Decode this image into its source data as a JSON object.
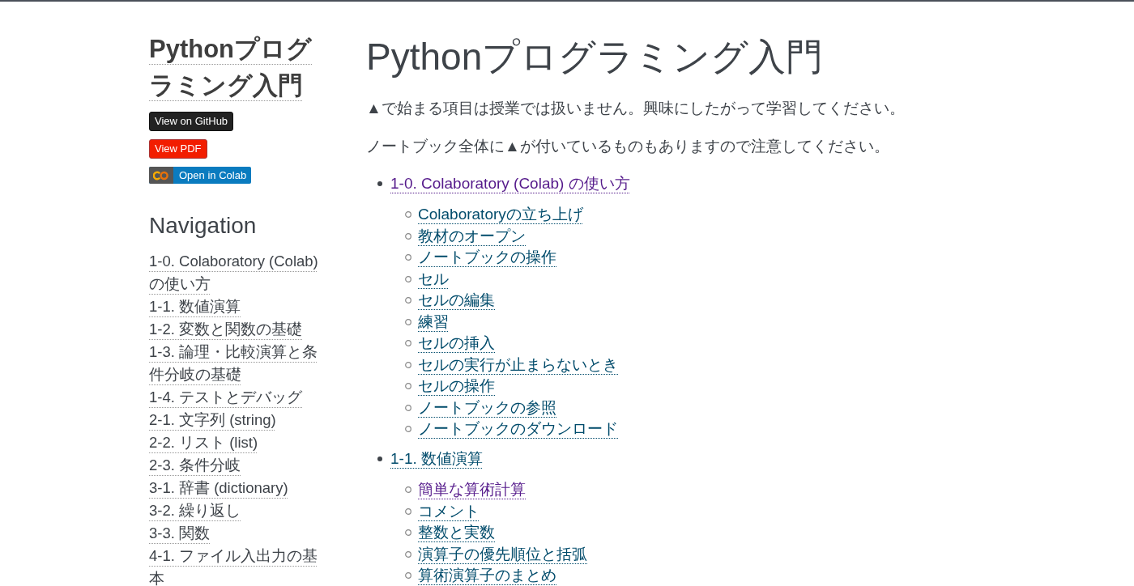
{
  "sidebar": {
    "title": "Pythonプログラミング入門",
    "badges": [
      {
        "kind": "github",
        "label": "View on GitHub"
      },
      {
        "kind": "pdf",
        "label": "View PDF"
      },
      {
        "kind": "colab",
        "label": "Open in Colab"
      }
    ],
    "navigation_heading": "Navigation",
    "nav_items": [
      "1-0. Colaboratory (Colab) の使い方",
      "1-1. 数値演算",
      "1-2. 変数と関数の基礎",
      "1-3. 論理・比較演算と条件分岐の基礎",
      "1-4. テストとデバッグ",
      "2-1. 文字列 (string)",
      "2-2. リスト (list)",
      "2-3. 条件分岐",
      "3-1. 辞書 (dictionary)",
      "3-2. 繰り返し",
      "3-3. 関数",
      "4-1. ファイル入出力の基本"
    ]
  },
  "main": {
    "title": "Pythonプログラミング入門",
    "paragraphs": [
      "▲で始まる項目は授業では扱いません。興味にしたがって学習してください。",
      "ノートブック全体に▲が付いているものもありますので注意してください。"
    ],
    "toc": [
      {
        "label": "1-0. Colaboratory (Colab) の使い方",
        "visited": true,
        "children": [
          {
            "label": "Colaboratoryの立ち上げ",
            "visited": false
          },
          {
            "label": "教材のオープン",
            "visited": false
          },
          {
            "label": "ノートブックの操作",
            "visited": false
          },
          {
            "label": "セル",
            "visited": false
          },
          {
            "label": "セルの編集",
            "visited": false
          },
          {
            "label": "練習",
            "visited": false
          },
          {
            "label": "セルの挿入",
            "visited": false
          },
          {
            "label": "セルの実行が止まらないとき",
            "visited": false
          },
          {
            "label": "セルの操作",
            "visited": false
          },
          {
            "label": "ノートブックの参照",
            "visited": false
          },
          {
            "label": "ノートブックのダウンロード",
            "visited": false
          }
        ]
      },
      {
        "label": "1-1. 数値演算",
        "visited": false,
        "children": [
          {
            "label": "簡単な算術計算",
            "visited": true
          },
          {
            "label": "コメント",
            "visited": false
          },
          {
            "label": "整数と実数",
            "visited": false
          },
          {
            "label": "演算子の優先順位と括弧",
            "visited": false
          },
          {
            "label": "算術演算子のまとめ",
            "visited": false
          }
        ]
      }
    ]
  }
}
